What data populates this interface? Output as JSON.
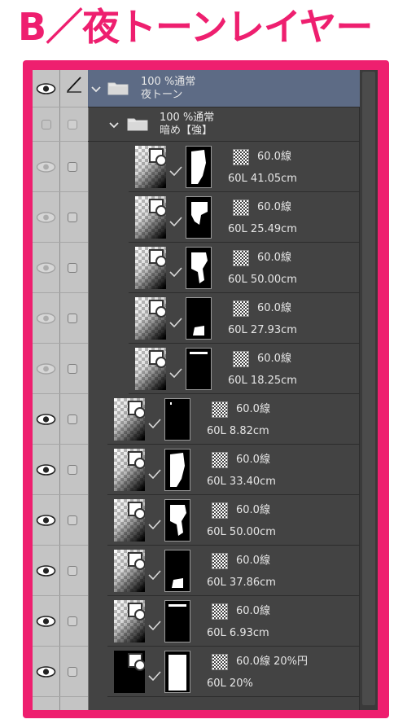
{
  "title": "B／夜トーンレイヤー",
  "colors": {
    "accent": "#ee1f6f",
    "panel": "#434343",
    "selected": "#5d6b85"
  },
  "groups": [
    {
      "line1": "100 %通常",
      "line2": "夜トーン",
      "selected": true
    },
    {
      "line1": "100 %通常",
      "line2": "暗め【強】",
      "selected": false
    }
  ],
  "layers": [
    {
      "line1": "60.0線",
      "line2": "60L 41.05cm",
      "visible": false,
      "indent": "inner",
      "mask": "shape1"
    },
    {
      "line1": "60.0線",
      "line2": "60L 25.49cm",
      "visible": false,
      "indent": "inner",
      "mask": "shape2"
    },
    {
      "line1": "60.0線",
      "line2": "60L 50.00cm",
      "visible": false,
      "indent": "inner",
      "mask": "shape3"
    },
    {
      "line1": "60.0線",
      "line2": "60L 27.93cm",
      "visible": false,
      "indent": "inner",
      "mask": "shape4"
    },
    {
      "line1": "60.0線",
      "line2": "60L 18.25cm",
      "visible": false,
      "indent": "inner",
      "mask": "shape5"
    },
    {
      "line1": "60.0線",
      "line2": "60L 8.82cm",
      "visible": true,
      "indent": "outer",
      "mask": "shape6"
    },
    {
      "line1": "60.0線",
      "line2": "60L 33.40cm",
      "visible": true,
      "indent": "outer",
      "mask": "shape1"
    },
    {
      "line1": "60.0線",
      "line2": "60L 50.00cm",
      "visible": true,
      "indent": "outer",
      "mask": "shape3"
    },
    {
      "line1": "60.0線",
      "line2": "60L 37.86cm",
      "visible": true,
      "indent": "outer",
      "mask": "shape4"
    },
    {
      "line1": "60.0線",
      "line2": "60L 6.93cm",
      "visible": true,
      "indent": "outer",
      "mask": "shape5"
    },
    {
      "line1": "60.0線 20%円",
      "line2": "60L 20%",
      "visible": true,
      "indent": "outer",
      "mask": "shape7"
    }
  ]
}
